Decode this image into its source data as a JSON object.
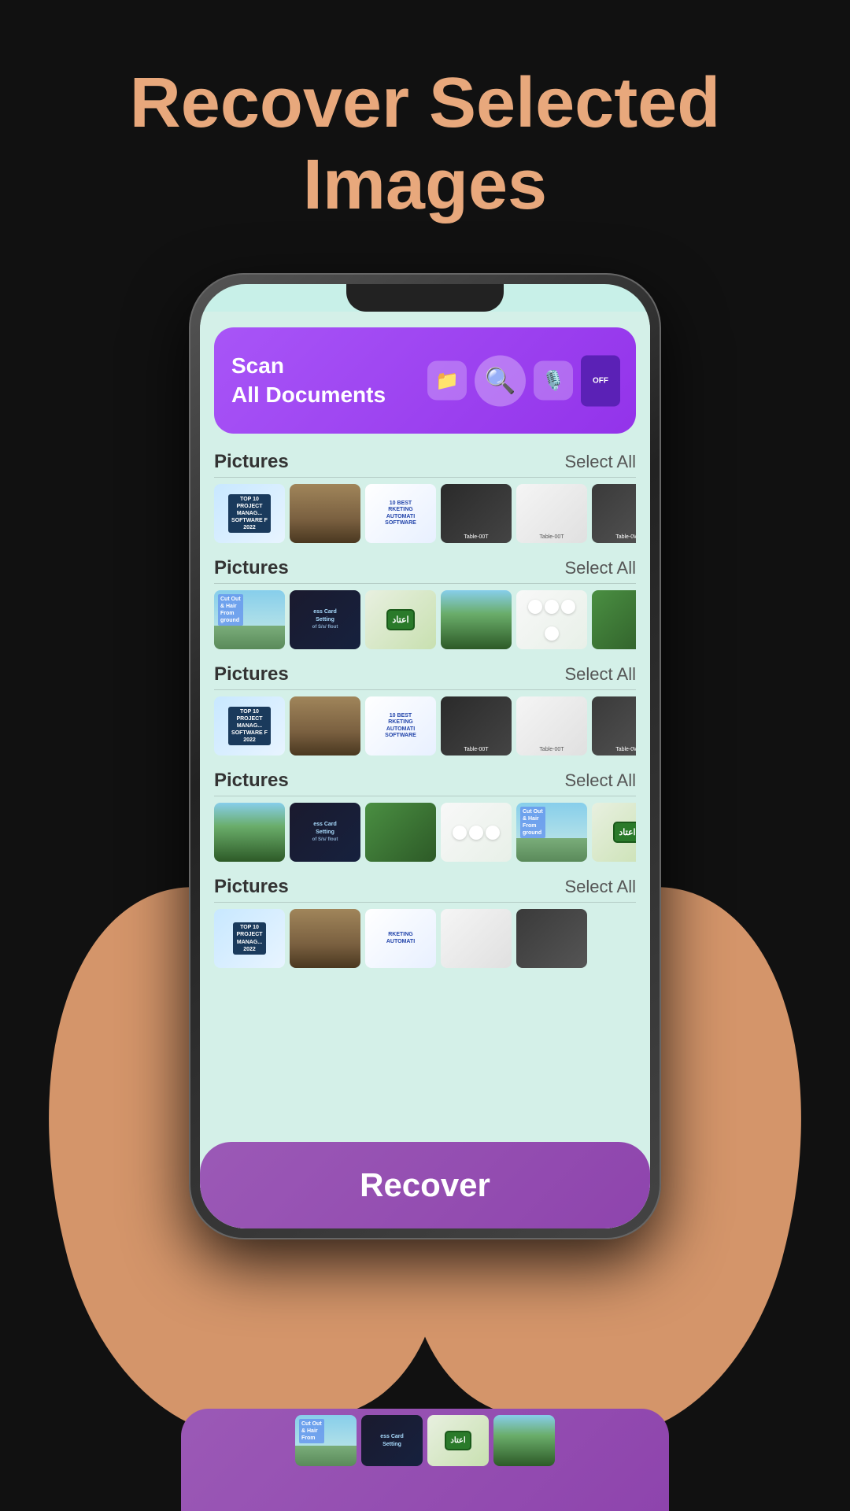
{
  "page": {
    "title_line1": "Recover Selected",
    "title_line2": "Images",
    "title_color": "#e8a87c"
  },
  "banner": {
    "line1": "Scan",
    "line2": "All Documents"
  },
  "sections": [
    {
      "id": "section1",
      "label": "Pictures",
      "select_all": "Select All",
      "thumbnails": [
        {
          "id": "t1",
          "type": "blue-chart",
          "label": "TOP 10 PROJECT MANAG..."
        },
        {
          "id": "t2",
          "type": "desk-brown",
          "label": ""
        },
        {
          "id": "t3",
          "type": "whiteboard",
          "label": "10 BEST RKETING AUTOMATI SOFTWARE"
        },
        {
          "id": "t4",
          "type": "desk-dark",
          "label": "Table-00T"
        },
        {
          "id": "t5",
          "type": "shelf-white",
          "label": "Table-00T"
        },
        {
          "id": "t6",
          "type": "shelf-dark",
          "label": "Table-0W"
        }
      ]
    },
    {
      "id": "section2",
      "label": "Pictures",
      "select_all": "Select All",
      "thumbnails": [
        {
          "id": "t7",
          "type": "cutout",
          "label": "Cut Out & Hair From ground"
        },
        {
          "id": "t8",
          "type": "card",
          "label": "ess Card Setting"
        },
        {
          "id": "t9",
          "type": "itad",
          "label": ""
        },
        {
          "id": "t10",
          "type": "green-mountain",
          "label": ""
        },
        {
          "id": "t11",
          "type": "white-flowers",
          "label": ""
        },
        {
          "id": "t12",
          "type": "green-moss",
          "label": ""
        }
      ]
    },
    {
      "id": "section3",
      "label": "Pictures",
      "select_all": "Select All",
      "thumbnails": [
        {
          "id": "t13",
          "type": "blue-chart",
          "label": "TOP 10 PROJECT MANAG..."
        },
        {
          "id": "t14",
          "type": "desk-brown",
          "label": ""
        },
        {
          "id": "t15",
          "type": "whiteboard",
          "label": "10 BEST RKETING AUTOMATI SOFTWARE"
        },
        {
          "id": "t16",
          "type": "desk-dark",
          "label": "Table-00T"
        },
        {
          "id": "t17",
          "type": "shelf-white",
          "label": "Table-00T"
        },
        {
          "id": "t18",
          "type": "shelf-dark",
          "label": "Table-0W"
        }
      ]
    },
    {
      "id": "section4",
      "label": "Pictures",
      "select_all": "Select All",
      "thumbnails": [
        {
          "id": "t19",
          "type": "green-mountain",
          "label": ""
        },
        {
          "id": "t20",
          "type": "card",
          "label": "ess Card Setting"
        },
        {
          "id": "t21",
          "type": "green-moss",
          "label": ""
        },
        {
          "id": "t22",
          "type": "white-flowers",
          "label": ""
        },
        {
          "id": "t23",
          "type": "cutout",
          "label": "Cut Out & Hair From ground"
        },
        {
          "id": "t24",
          "type": "itad",
          "label": ""
        }
      ]
    },
    {
      "id": "section5",
      "label": "Pictures",
      "select_all": "Select All",
      "thumbnails": [
        {
          "id": "t25",
          "type": "blue-chart",
          "label": "TOP 10 PROJECT MANAG..."
        },
        {
          "id": "t26",
          "type": "desk-brown",
          "label": ""
        },
        {
          "id": "t27",
          "type": "whiteboard",
          "label": ""
        },
        {
          "id": "t28",
          "type": "shelf-white",
          "label": ""
        },
        {
          "id": "t29",
          "type": "shelf-dark",
          "label": ""
        }
      ]
    }
  ],
  "recover_button": {
    "label": "Recover"
  },
  "bottom_row": {
    "thumbnails": [
      {
        "id": "b1",
        "type": "cutout",
        "label": "Cut Out & Hair From"
      },
      {
        "id": "b2",
        "type": "card",
        "label": "ess Card Setting"
      },
      {
        "id": "b3",
        "type": "itad",
        "label": ""
      },
      {
        "id": "b4",
        "type": "green-mountain",
        "label": ""
      }
    ]
  }
}
